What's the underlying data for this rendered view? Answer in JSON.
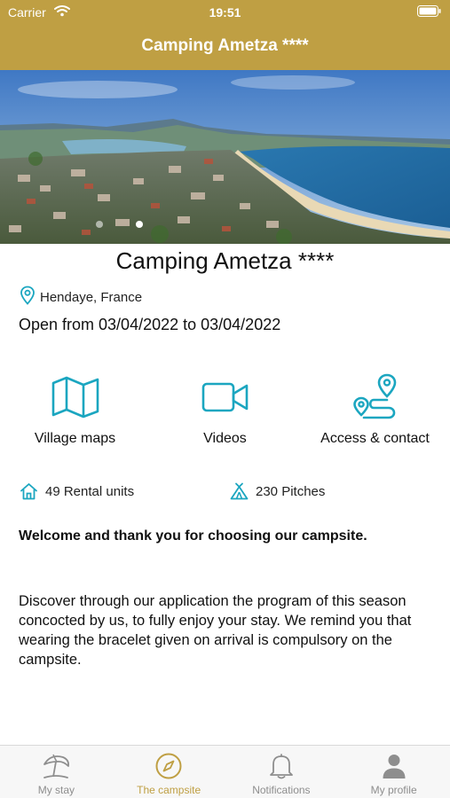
{
  "status_bar": {
    "carrier": "Carrier",
    "time": "19:51"
  },
  "header": {
    "title": "Camping Ametza ****"
  },
  "carousel": {
    "slide_count": 2,
    "active_index": 1
  },
  "campsite": {
    "name": "Camping Ametza ****",
    "location": "Hendaye, France",
    "opening": "Open from 03/04/2022 to 03/04/2022"
  },
  "features": [
    {
      "label": "Village maps",
      "icon": "map-icon"
    },
    {
      "label": "Videos",
      "icon": "video-camera-icon"
    },
    {
      "label": "Access & contact",
      "icon": "route-icon"
    }
  ],
  "stats": {
    "rental_units": "49 Rental units",
    "pitches": "230 Pitches"
  },
  "welcome": "Welcome and thank you for choosing our campsite.",
  "description": "Discover through our application the program of this season concocted by us, to fully enjoy your stay. We remind you that wearing the bracelet given on arrival is compulsory on the campsite.",
  "tabs": [
    {
      "label": "My stay",
      "icon": "beach-umbrella-icon",
      "active": false
    },
    {
      "label": "The campsite",
      "icon": "compass-icon",
      "active": true
    },
    {
      "label": "Notifications",
      "icon": "bell-icon",
      "active": false
    },
    {
      "label": "My profile",
      "icon": "person-icon",
      "active": false
    }
  ],
  "colors": {
    "brand_gold": "#bf9f43",
    "accent_teal": "#1ba6c0",
    "tab_inactive": "#8e8e8e"
  }
}
